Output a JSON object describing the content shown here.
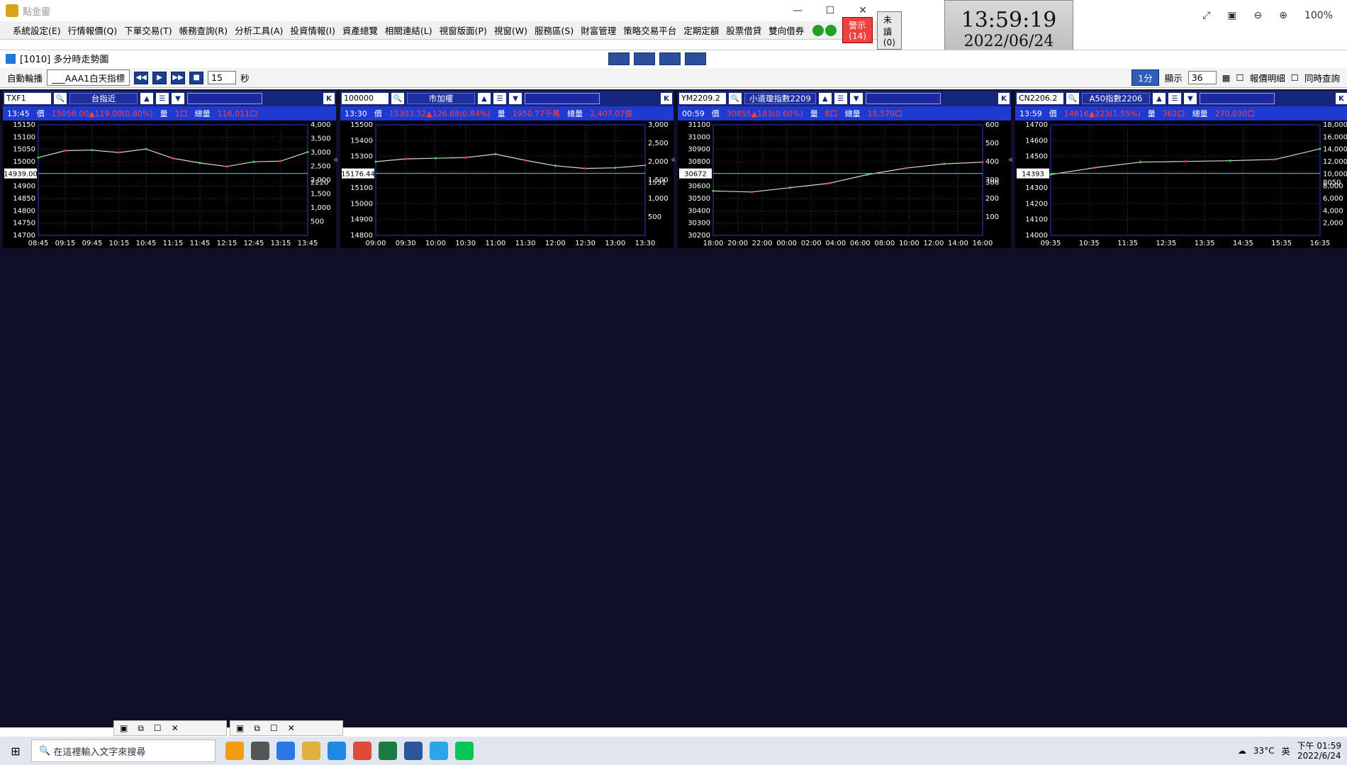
{
  "app": {
    "title": "點金靈",
    "win_controls": [
      "—",
      "☐",
      "✕"
    ]
  },
  "menu": {
    "items": [
      "系統設定(E)",
      "行情報價(Q)",
      "下單交易(T)",
      "帳務查詢(R)",
      "分析工具(A)",
      "投資情報(I)",
      "資產總覽",
      "相關連結(L)",
      "視窗版面(P)",
      "視窗(W)",
      "服務區(S)",
      "財富管理",
      "策略交易平台",
      "定期定額",
      "股票借貸",
      "雙向借券"
    ],
    "warning_label": "警示(14)",
    "unread_label": "未讀(0)"
  },
  "clock": {
    "time": "13:59:19",
    "date": "2022/06/24"
  },
  "right_toolbar": {
    "zoom": "100%"
  },
  "window": {
    "title": "[1010] 多分時走勢圖"
  },
  "control_bar": {
    "auto_label": "自動輪播",
    "auto_select": "___AAA1白天指標",
    "interval": "15",
    "unit": "秒",
    "timeframe": "1分",
    "display_label": "顯示",
    "display_value": "36",
    "chk1": "報價明細",
    "chk2": "同時查詢"
  },
  "colors": {
    "price_line": "#d8d8d8",
    "avg_line": "#c0c0c0",
    "vol": "#ff8a3d",
    "up": "#ff3030",
    "down": "#30e030"
  },
  "panels": [
    {
      "id": "p1",
      "sym": "TXF1",
      "name": "台指近",
      "time": "13:45",
      "price_lbl": "價",
      "price": "15058.00▲119.00(0.80%)",
      "vol_lbl": "量",
      "vol": "1口",
      "tvol_lbl": "總量",
      "tvol": "116,011口",
      "ref_lbl": "14939.00",
      "vol_ref_lbl": "2220",
      "yticks": [
        "15150",
        "15100",
        "15050",
        "15000",
        "14950",
        "14900",
        "14850",
        "14800",
        "14750",
        "14700"
      ],
      "vticks": [
        "4,000",
        "3,500",
        "3,000",
        "2,500",
        "2,000",
        "1,500",
        "1,000",
        "500"
      ],
      "xticks": [
        "08:45",
        "09:15",
        "09:45",
        "10:15",
        "10:45",
        "11:15",
        "11:45",
        "12:15",
        "12:45",
        "13:15",
        "13:45"
      ],
      "series": [
        {
          "x": "08:45",
          "y": 15034
        },
        {
          "x": "09:15",
          "y": 15064
        },
        {
          "x": "09:45",
          "y": 15066
        },
        {
          "x": "10:15",
          "y": 15056
        },
        {
          "x": "10:45",
          "y": 15071
        },
        {
          "x": "11:15",
          "y": 15031
        },
        {
          "x": "11:45",
          "y": 15011
        },
        {
          "x": "12:15",
          "y": 14996
        },
        {
          "x": "12:45",
          "y": 15016
        },
        {
          "x": "13:15",
          "y": 15019
        },
        {
          "x": "13:45",
          "y": 15058
        }
      ],
      "ymin": 14700,
      "ymax": 15175
    },
    {
      "id": "p2",
      "sym": "100000",
      "name": "市加權",
      "time": "13:30",
      "price_lbl": "價",
      "price": "15303.32▲126.88(0.84%)",
      "vol_lbl": "量",
      "vol": "1950.77千萬",
      "tvol_lbl": "總量",
      "tvol": "2,407.07億",
      "ref_lbl": "15176.44",
      "vol_ref_lbl": "1551",
      "yticks": [
        "15500",
        "15400",
        "15300",
        "15200",
        "15100",
        "15000",
        "14900",
        "14800"
      ],
      "vticks": [
        "3,000",
        "2,500",
        "2,000",
        "1,500",
        "1,000",
        "500"
      ],
      "xticks": [
        "09:00",
        "09:30",
        "10:00",
        "10:30",
        "11:00",
        "11:30",
        "12:00",
        "12:30",
        "13:00",
        "13:30"
      ],
      "series": [
        {
          "x": "09:00",
          "y": 15330
        },
        {
          "x": "09:30",
          "y": 15350
        },
        {
          "x": "10:00",
          "y": 15355
        },
        {
          "x": "10:30",
          "y": 15360
        },
        {
          "x": "11:00",
          "y": 15385
        },
        {
          "x": "11:30",
          "y": 15340
        },
        {
          "x": "12:00",
          "y": 15300
        },
        {
          "x": "12:30",
          "y": 15280
        },
        {
          "x": "13:00",
          "y": 15285
        },
        {
          "x": "13:30",
          "y": 15303
        }
      ],
      "ymin": 14790,
      "ymax": 15600
    },
    {
      "id": "p3",
      "sym": "YM2209.2",
      "name": "小道瓊指數2209",
      "time": "00:59",
      "price_lbl": "價",
      "price": "30855▲183(0.60%)",
      "vol_lbl": "量",
      "vol": "8口",
      "tvol_lbl": "總量",
      "tvol": "15,579口",
      "ref_lbl": "30672",
      "vol_ref_lbl": "306",
      "yticks": [
        "31100",
        "31000",
        "30900",
        "30800",
        "30700",
        "30600",
        "30500",
        "30400",
        "30300",
        "30200"
      ],
      "vticks": [
        "600",
        "500",
        "400",
        "300",
        "200",
        "100"
      ],
      "xticks": [
        "18:00",
        "20:00",
        "22:00",
        "00:00",
        "02:00",
        "04:00",
        "06:00",
        "08:00",
        "10:00",
        "12:00",
        "14:00",
        "16:00"
      ],
      "series": [
        {
          "x": "18:00",
          "y": 30590
        },
        {
          "x": "19:00",
          "y": 30580
        },
        {
          "x": "20:00",
          "y": 30620
        },
        {
          "x": "21:00",
          "y": 30660
        },
        {
          "x": "22:00",
          "y": 30740
        },
        {
          "x": "23:00",
          "y": 30800
        },
        {
          "x": "00:00",
          "y": 30840
        },
        {
          "x": "00:59",
          "y": 30855
        }
      ],
      "ymin": 30180,
      "ymax": 31200
    },
    {
      "id": "p4",
      "sym": "CN2206.2",
      "name": "A50指數2206",
      "time": "13:59",
      "price_lbl": "價",
      "price": "14616▲223(1.55%)",
      "vol_lbl": "量",
      "vol": "362口",
      "tvol_lbl": "總量",
      "tvol": "270,030口",
      "ref_lbl": "14393",
      "vol_ref_lbl": "8050",
      "yticks": [
        "14700",
        "14600",
        "14500",
        "14400",
        "14300",
        "14200",
        "14100",
        "14000"
      ],
      "vticks": [
        "18,000",
        "16,000",
        "14,000",
        "12,000",
        "10,000",
        "8,000",
        "6,000",
        "4,000",
        "2,000"
      ],
      "xticks": [
        "09:35",
        "10:35",
        "11:35",
        "12:35",
        "13:35",
        "14:35",
        "15:35",
        "16:35"
      ],
      "series": [
        {
          "x": "09:00",
          "y": 14430
        },
        {
          "x": "09:35",
          "y": 14480
        },
        {
          "x": "10:35",
          "y": 14520
        },
        {
          "x": "11:35",
          "y": 14525
        },
        {
          "x": "12:35",
          "y": 14530
        },
        {
          "x": "13:35",
          "y": 14540
        },
        {
          "x": "13:59",
          "y": 14616
        }
      ],
      "ymin": 13990,
      "ymax": 14790
    }
  ],
  "taskbar": {
    "search_placeholder": "在這裡輸入文字來搜尋",
    "weather": "33°C",
    "ime": "英",
    "time": "下午 01:59",
    "date": "2022/6/24"
  }
}
